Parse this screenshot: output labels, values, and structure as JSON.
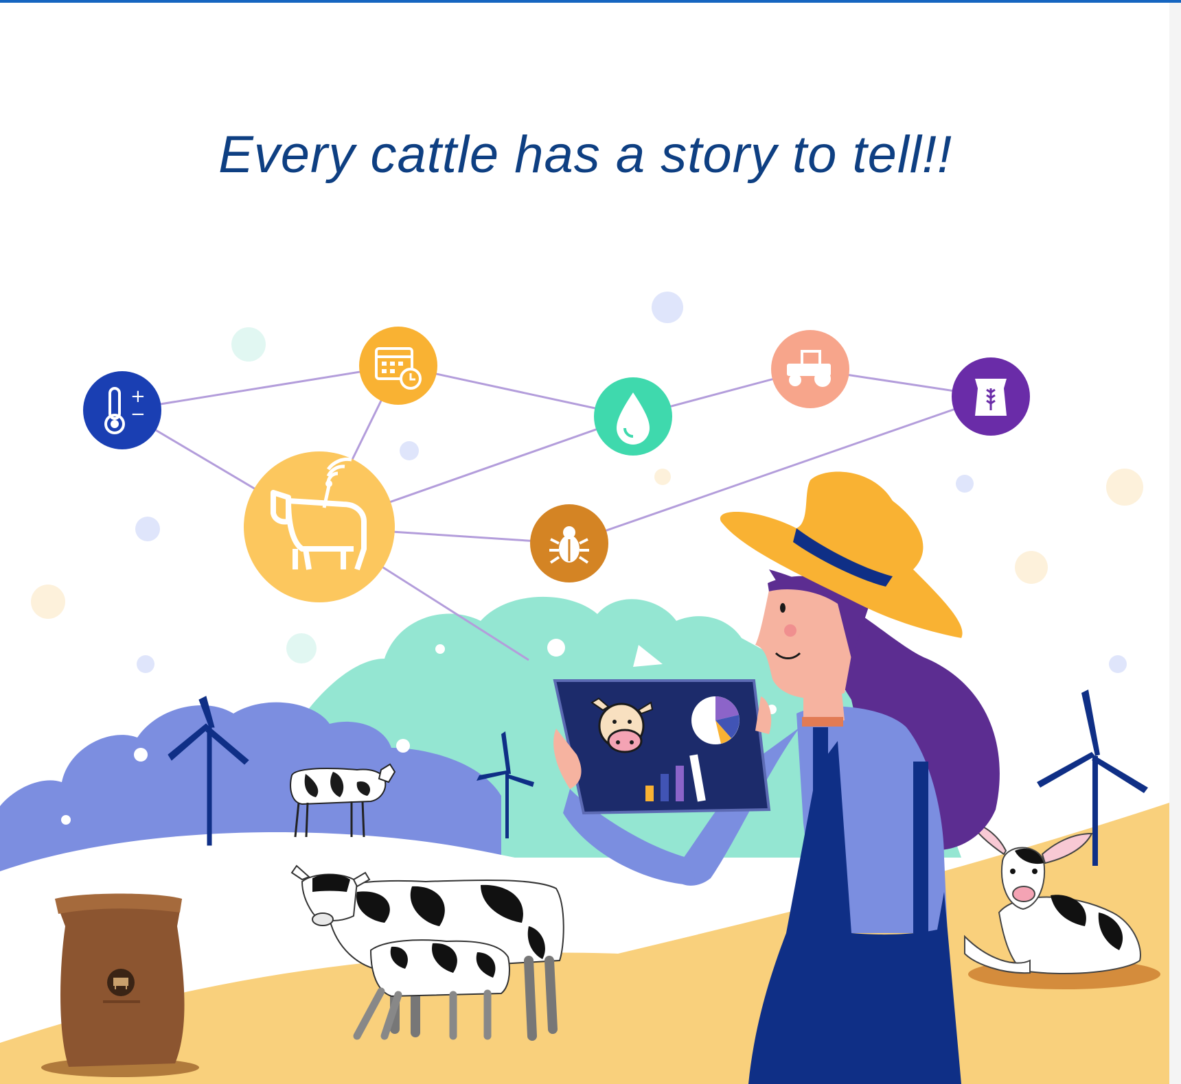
{
  "headline": "Every cattle has a story to tell!!",
  "colors": {
    "headline": "#0e3f82",
    "top_rule": "#1565c0",
    "network_line": "#b39ddb",
    "hat": "#f9b233",
    "hair": "#5c2d91",
    "overalls": "#0f2f86",
    "sleeve": "#7b8ee0",
    "ground": "#f9d07c",
    "hill_blue": "#7c8ee0",
    "hill_mint": "#94e6d2"
  },
  "network_icons": [
    {
      "name": "temperature-icon",
      "color": "#1a3fb3"
    },
    {
      "name": "calendar-clock-icon",
      "color": "#f9b233"
    },
    {
      "name": "water-drop-icon",
      "color": "#3fd9ad"
    },
    {
      "name": "tractor-icon",
      "color": "#f7a58b"
    },
    {
      "name": "feed-sack-icon",
      "color": "#6a2ca8"
    },
    {
      "name": "connected-cow-icon",
      "color": "#fcc75e"
    },
    {
      "name": "bug-icon",
      "color": "#d48424"
    }
  ]
}
